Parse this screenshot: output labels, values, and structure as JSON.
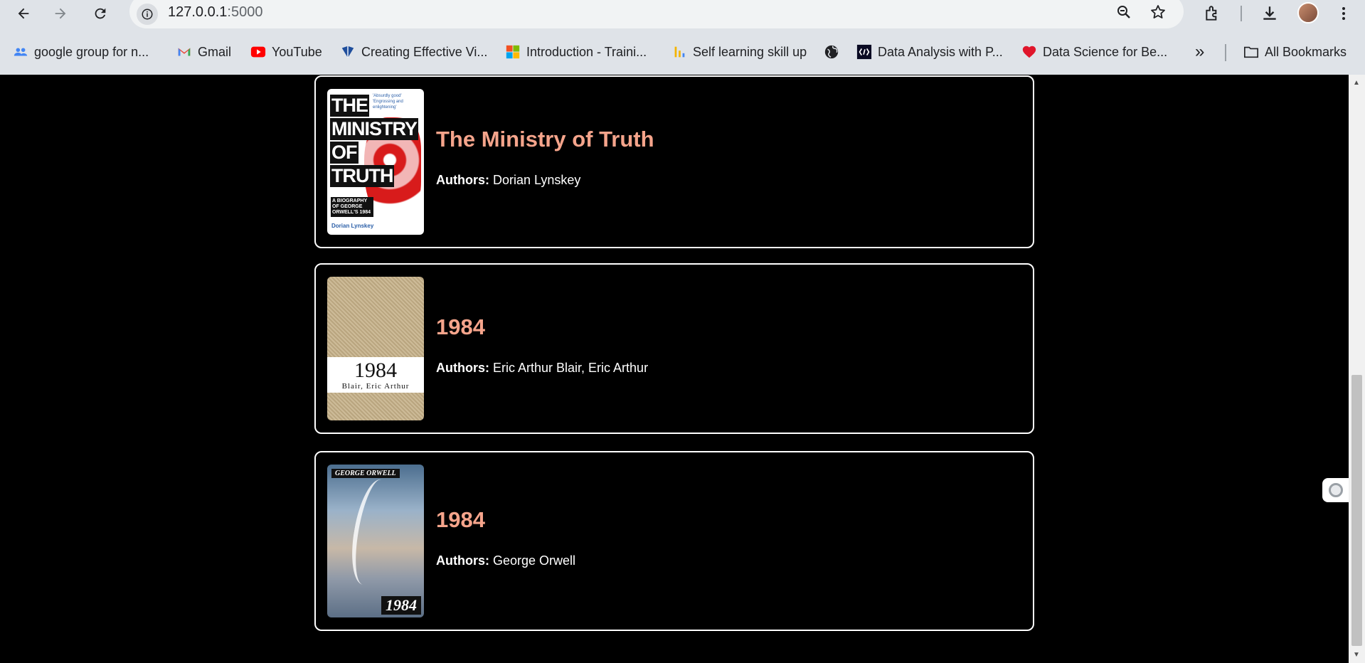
{
  "browser": {
    "url_host": "127.0.0.1",
    "url_port": ":5000",
    "bookmarks": [
      {
        "label": "google group for n...",
        "icon": "groups-icon"
      },
      {
        "label": "Gmail",
        "icon": "gmail-icon"
      },
      {
        "label": "YouTube",
        "icon": "youtube-icon"
      },
      {
        "label": "Creating Effective Vi...",
        "icon": "tableau-icon"
      },
      {
        "label": "Introduction - Traini...",
        "icon": "microsoft-icon"
      },
      {
        "label": "Self learning skill up",
        "icon": "chart-icon"
      },
      {
        "label": "",
        "icon": "globe-icon"
      },
      {
        "label": "Data Analysis with P...",
        "icon": "freecodecamp-icon"
      },
      {
        "label": "Data Science for Be...",
        "icon": "heart-icon"
      }
    ],
    "overflow_label": "»",
    "all_bookmarks_label": "All Bookmarks"
  },
  "books": [
    {
      "title": "The Ministry of Truth",
      "authors_label": "Authors:",
      "authors": " Dorian Lynskey",
      "cover": {
        "title_lines": [
          "THE",
          "MINISTRY",
          "OF",
          "TRUTH"
        ],
        "subtitle": "A BIOGRAPHY OF GEORGE ORWELL'S 1984",
        "author": "Dorian Lynskey",
        "quotes": "'Absurdly good' 'Engrossing and enlightening'"
      }
    },
    {
      "title": "1984",
      "authors_label": "Authors:",
      "authors": " Eric Arthur Blair, Eric Arthur",
      "cover": {
        "year": "1984",
        "byline": "Blair, Eric Arthur"
      }
    },
    {
      "title": "1984",
      "authors_label": "Authors:",
      "authors": " George Orwell",
      "cover": {
        "tag": "GEORGE ORWELL",
        "year": "1984"
      }
    }
  ],
  "colors": {
    "title": "#f5a48b",
    "card_border": "#ffffff",
    "background": "#000000"
  }
}
